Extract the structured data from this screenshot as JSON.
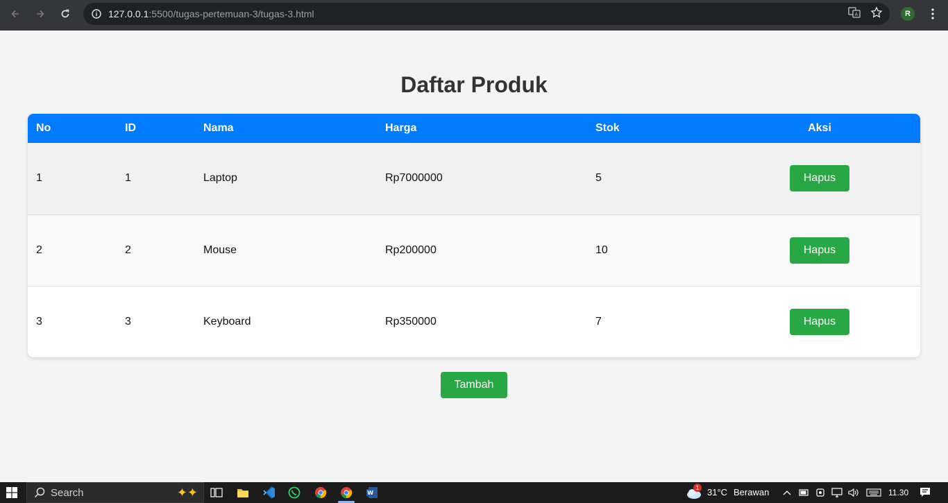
{
  "browser": {
    "url_host": "127.0.0.1",
    "url_rest": ":5500/tugas-pertemuan-3/tugas-3.html",
    "profile_initial": "R"
  },
  "page": {
    "title": "Daftar Produk",
    "columns": [
      "No",
      "ID",
      "Nama",
      "Harga",
      "Stok",
      "Aksi"
    ],
    "rows": [
      {
        "no": "1",
        "id": "1",
        "nama": "Laptop",
        "harga": "Rp7000000",
        "stok": "5",
        "action": "Hapus"
      },
      {
        "no": "2",
        "id": "2",
        "nama": "Mouse",
        "harga": "Rp200000",
        "stok": "10",
        "action": "Hapus"
      },
      {
        "no": "3",
        "id": "3",
        "nama": "Keyboard",
        "harga": "Rp350000",
        "stok": "7",
        "action": "Hapus"
      }
    ],
    "add_button": "Tambah"
  },
  "taskbar": {
    "search_placeholder": "Search",
    "weather_badge": "1",
    "temperature": "31°C",
    "weather": "Berawan",
    "time": "11.30"
  },
  "colors": {
    "header": "#007bff",
    "button": "#28a745",
    "chrome": "#35363a"
  }
}
